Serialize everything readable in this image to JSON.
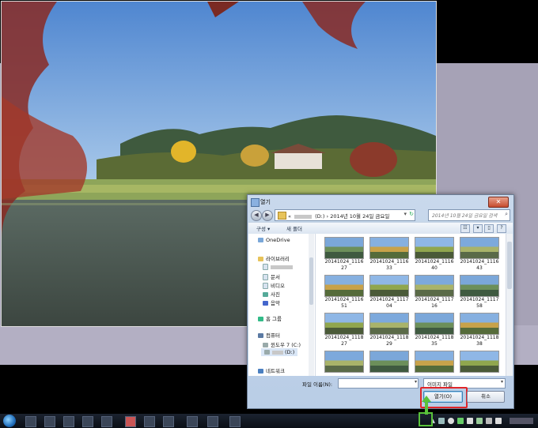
{
  "dialog": {
    "title": "열기",
    "close_glyph": "✕",
    "address": {
      "segments": [
        "«",
        "(D:)",
        "›",
        "2014년 10월 24일 금요일"
      ],
      "refresh_icon": "refresh-icon"
    },
    "search": {
      "placeholder": "2014년 10월 24일 금요일 검색"
    },
    "toolbar": {
      "organize_label": "구성 ▾",
      "new_folder_label": "새 폴더"
    },
    "nav_tree": [
      {
        "label": "OneDrive",
        "icon": "onedrive-icon"
      },
      {
        "label": "라이브러리",
        "icon": "library-icon"
      },
      {
        "label": "",
        "icon": "video-icon"
      },
      {
        "label": "문서",
        "icon": "document-icon"
      },
      {
        "label": "비디오",
        "icon": "video-icon"
      },
      {
        "label": "사진",
        "icon": "picture-icon"
      },
      {
        "label": "음악",
        "icon": "music-icon"
      },
      {
        "label": "홈 그룹",
        "icon": "homegroup-icon"
      },
      {
        "label": "컴퓨터",
        "icon": "computer-icon"
      },
      {
        "label": "윈도우 7 (C:)",
        "icon": "drive-icon"
      },
      {
        "label": "(D:)",
        "icon": "drive-icon"
      },
      {
        "label": "네트워크",
        "icon": "network-icon"
      }
    ],
    "files": [
      "20141024_111627",
      "20141024_111633",
      "20141024_111640",
      "20141024_111643",
      "20141024_111651",
      "20141024_111704",
      "20141024_111716",
      "20141024_111758",
      "20141024_111827",
      "20141024_111829",
      "20141024_111835",
      "20141024_111838",
      "",
      "",
      "",
      ""
    ],
    "filename_label": "파일 이름(N):",
    "filename_value": "",
    "filetype_value": "이미지 파일",
    "open_label": "열기(O)",
    "cancel_label": "취소"
  },
  "colors": {
    "sky": "#6f9fd4",
    "highlight_red": "#e0262a",
    "annotation_green": "#59c23a"
  }
}
